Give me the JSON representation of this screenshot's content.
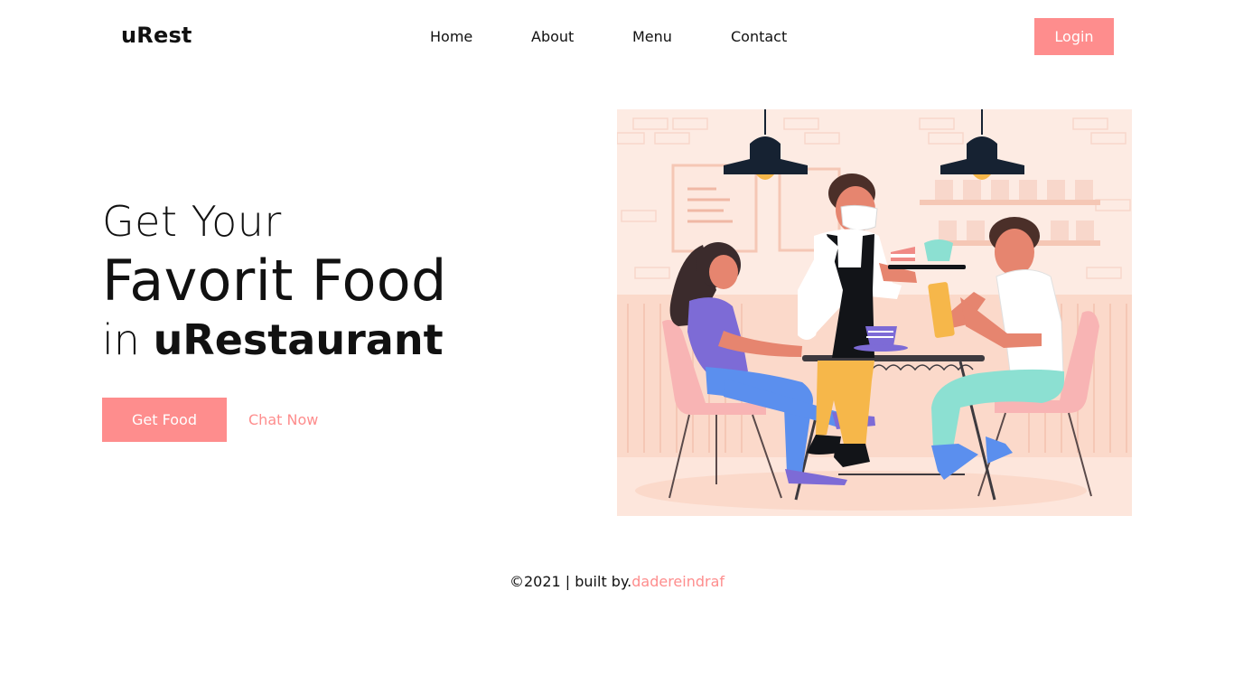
{
  "brand": {
    "name": "uRest"
  },
  "nav": {
    "items": [
      "Home",
      "About",
      "Menu",
      "Contact"
    ],
    "login_label": "Login"
  },
  "hero": {
    "line1": "Get Your",
    "line2": "Favorit Food",
    "line3_prefix": "in ",
    "line3_emphasis": "uRestaurant",
    "primary_cta": "Get Food",
    "secondary_cta": "Chat Now"
  },
  "illustration": {
    "name": "restaurant-scene-illustration"
  },
  "footer": {
    "copyright": "©2021 | built by.",
    "author": "dadereindraf"
  },
  "colors": {
    "accent": "#fe8d8d",
    "text": "#111111",
    "background": "#ffffff",
    "illustration_bg": "#fdebe3"
  }
}
